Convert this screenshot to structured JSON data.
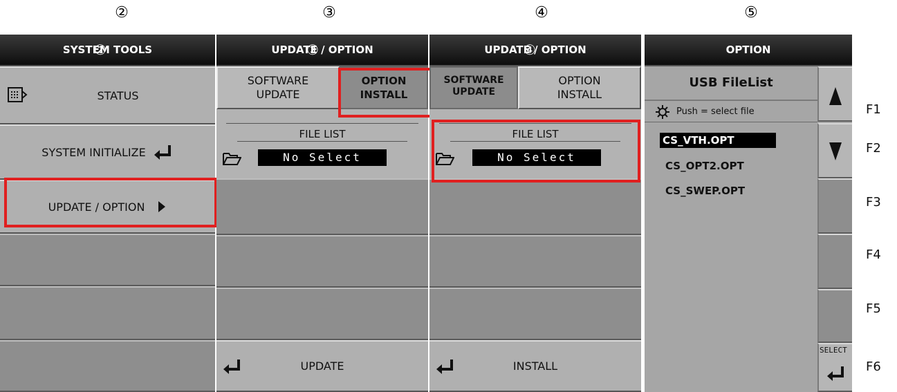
{
  "step_numbers": [
    "②",
    "③",
    "④",
    "⑤"
  ],
  "panel1": {
    "header": "SYSTEM TOOLS",
    "header_overlay": "②",
    "items": [
      "STATUS",
      "SYSTEM INITIALIZE",
      "UPDATE / OPTION"
    ]
  },
  "panel2": {
    "header": "UPDATE / OPTION",
    "header_overlay": "③",
    "tab_software_line1": "SOFTWARE",
    "tab_software_line2": "UPDATE",
    "tab_option_line1": "OPTION",
    "tab_option_line2": "INSTALL",
    "file_list_label": "FILE LIST",
    "file_value": "No Select",
    "bottom_button": "UPDATE"
  },
  "panel3": {
    "header": "UPDATE / OPTION",
    "header_overlay": "④",
    "tab_software_line1": "SOFTWARE",
    "tab_software_line2": "UPDATE",
    "tab_option_line1": "OPTION",
    "tab_option_line2": "INSTALL",
    "file_list_label": "FILE LIST",
    "file_value": "No Select",
    "bottom_button": "INSTALL"
  },
  "panel4": {
    "header": "OPTION",
    "title": "USB FileList",
    "hint": "Push = select file",
    "files": [
      "CS_VTH.OPT",
      "CS_OPT2.OPT",
      "CS_SWEP.OPT"
    ],
    "select_label": "SELECT"
  },
  "fkeys": [
    "F1",
    "F2",
    "F3",
    "F4",
    "F5",
    "F6"
  ]
}
